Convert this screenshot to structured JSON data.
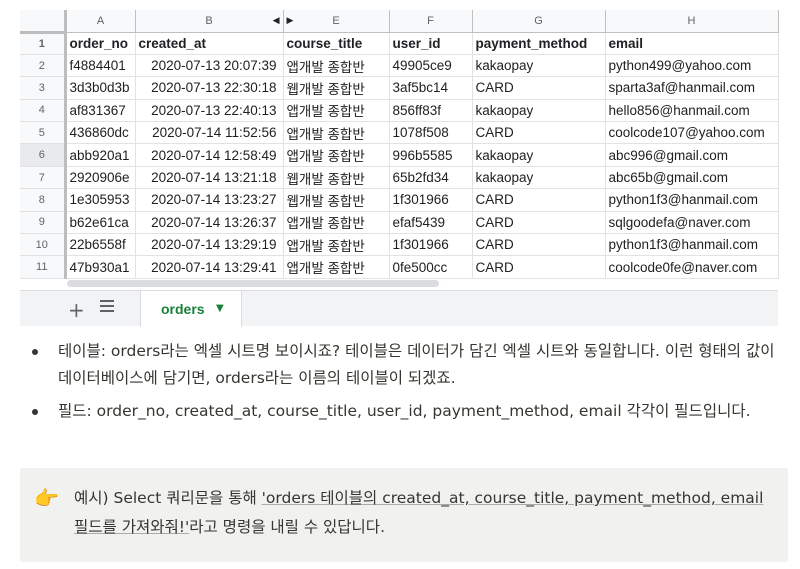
{
  "sheet": {
    "columns": [
      "A",
      "B",
      "E",
      "F",
      "G",
      "H"
    ],
    "rows": [
      {
        "n": "1",
        "cells": [
          "order_no",
          "created_at",
          "course_title",
          "user_id",
          "payment_method",
          "email"
        ]
      },
      {
        "n": "2",
        "cells": [
          "f4884401",
          "2020-07-13 20:07:39",
          "앱개발 종합반",
          "49905ce9",
          "kakaopay",
          "python499@yahoo.com"
        ]
      },
      {
        "n": "3",
        "cells": [
          "3d3b0d3b",
          "2020-07-13 22:30:18",
          "웹개발 종합반",
          "3af5bc14",
          "CARD",
          "sparta3af@hanmail.com"
        ]
      },
      {
        "n": "4",
        "cells": [
          "af831367",
          "2020-07-13 22:40:13",
          "앱개발 종합반",
          "856ff83f",
          "kakaopay",
          "hello856@hanmail.com"
        ]
      },
      {
        "n": "5",
        "cells": [
          "436860dc",
          "2020-07-14 11:52:56",
          "앱개발 종합반",
          "1078f508",
          "CARD",
          "coolcode107@yahoo.com"
        ]
      },
      {
        "n": "6",
        "cells": [
          "abb920a1",
          "2020-07-14 12:58:49",
          "앱개발 종합반",
          "996b5585",
          "kakaopay",
          "abc996@gmail.com"
        ]
      },
      {
        "n": "7",
        "cells": [
          "2920906e",
          "2020-07-14 13:21:18",
          "웹개발 종합반",
          "65b2fd34",
          "kakaopay",
          "abc65b@gmail.com"
        ]
      },
      {
        "n": "8",
        "cells": [
          "1e305953",
          "2020-07-14 13:23:27",
          "웹개발 종합반",
          "1f301966",
          "CARD",
          "python1f3@hanmail.com"
        ]
      },
      {
        "n": "9",
        "cells": [
          "b62e61ca",
          "2020-07-14 13:26:37",
          "앱개발 종합반",
          "efaf5439",
          "CARD",
          "sqlgoodefa@naver.com"
        ]
      },
      {
        "n": "10",
        "cells": [
          "22b6558f",
          "2020-07-14 13:29:19",
          "앱개발 종합반",
          "1f301966",
          "CARD",
          "python1f3@hanmail.com"
        ]
      },
      {
        "n": "11",
        "cells": [
          "47b930a1",
          "2020-07-14 13:29:41",
          "앱개발 종합반",
          "0fe500cc",
          "CARD",
          "coolcode0fe@naver.com"
        ]
      }
    ],
    "tab_label": "orders",
    "tab_caret": "▼",
    "add_sheet": "+",
    "hidden_left_arrow": "◀",
    "hidden_right_arrow": "▶"
  },
  "bullets": [
    "테이블: orders라는 엑셀 시트명 보이시죠? 테이블은 데이터가 담긴 엑셀 시트와 동일합니다. 이런 형태의 값이 데이터베이스에 담기면, orders라는 이름의 테이블이 되겠죠.",
    "필드: order_no, created_at, course_title, user_id, payment_method, email 각각이 필드입니다."
  ],
  "callout": {
    "emoji": "👉",
    "prefix": "예시) Select 쿼리문을 통해 ",
    "underlined": "'orders 테이블의 created_at, course_title, payment_method, email 필드를 가져와줘!'",
    "suffix": "라고 명령을 내릴 수 있답니다."
  },
  "colors": {
    "tab_green": "#188038",
    "callout_bg": "#f1f1ef",
    "header_bg": "#f8f9fa"
  }
}
